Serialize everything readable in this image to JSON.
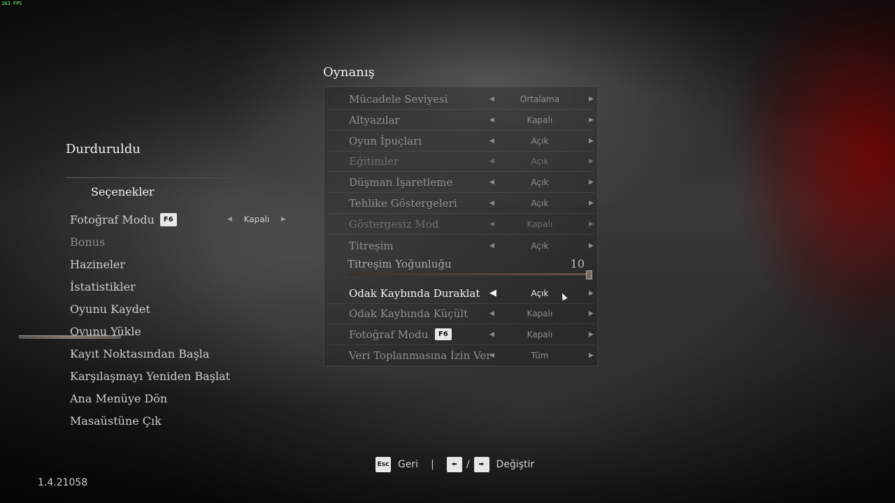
{
  "fps": "163 FPS",
  "left": {
    "title": "Durduruldu",
    "options_label": "Seçenekler",
    "photo_mode": {
      "label": "Fotoğraf Modu",
      "key": "F6",
      "value": "Kapalı"
    },
    "items": [
      {
        "label": "Bonus"
      },
      {
        "label": "Hazineler"
      },
      {
        "label": "İstatistikler"
      },
      {
        "label": "Oyunu Kaydet"
      },
      {
        "label": "Oyunu Yükle"
      },
      {
        "label": "Kayıt Noktasından Başla"
      },
      {
        "label": "Karşılaşmayı Yeniden Başlat"
      },
      {
        "label": "Ana Menüye Dön"
      },
      {
        "label": "Masaüstüne Çık"
      }
    ]
  },
  "section": {
    "title": "Oynanış",
    "rows": [
      {
        "label": "Mücadele Seviyesi",
        "value": "Ortalama"
      },
      {
        "label": "Altyazılar",
        "value": "Kapalı"
      },
      {
        "label": "Oyun İpuçları",
        "value": "Açık"
      },
      {
        "label": "Eğitimler",
        "value": "Açık"
      },
      {
        "label": "Düşman İşaretleme",
        "value": "Açık"
      },
      {
        "label": "Tehlike Göstergeleri",
        "value": "Açık"
      },
      {
        "label": "Göstergesiz Mod",
        "value": "Kapalı"
      },
      {
        "label": "Titreşim",
        "value": "Açık"
      }
    ],
    "slider": {
      "label": "Titreşim Yoğunluğu",
      "value": "10"
    },
    "rows2": [
      {
        "label": "Odak Kaybında Duraklat",
        "value": "Açık"
      },
      {
        "label": "Odak Kaybında Küçült",
        "value": "Kapalı"
      },
      {
        "label": "Fotoğraf Modu",
        "value": "Kapalı",
        "key": "F6"
      },
      {
        "label": "Veri Toplanmasına İzin Ver",
        "value": "Tüm"
      }
    ]
  },
  "hints": {
    "esc_key": "Esc",
    "back": "Geri",
    "divider": "|",
    "slash": "/",
    "change": "Değiştir"
  },
  "version": "1.4.21058"
}
